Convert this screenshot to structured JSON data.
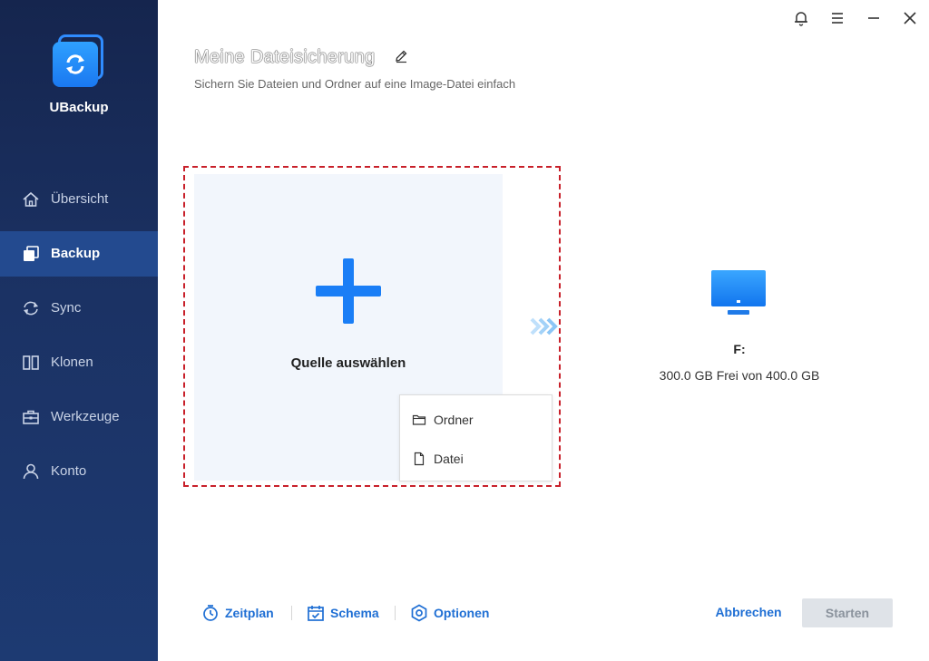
{
  "app": {
    "brand": "UBackup"
  },
  "sidebar": {
    "items": [
      {
        "label": "Übersicht",
        "icon": "home-icon"
      },
      {
        "label": "Backup",
        "icon": "backup-icon",
        "active": true
      },
      {
        "label": "Sync",
        "icon": "sync-icon"
      },
      {
        "label": "Klonen",
        "icon": "clone-icon"
      },
      {
        "label": "Werkzeuge",
        "icon": "toolbox-icon"
      },
      {
        "label": "Konto",
        "icon": "user-icon"
      }
    ]
  },
  "window_controls": [
    "bell-icon",
    "menu-icon",
    "minimize-icon",
    "close-icon"
  ],
  "task": {
    "title": "Meine Dateisicherung",
    "subtitle": "Sichern Sie Dateien und Ordner auf eine Image-Datei einfach"
  },
  "source": {
    "label": "Quelle auswählen",
    "menu": [
      {
        "label": "Ordner",
        "icon": "folder-icon"
      },
      {
        "label": "Datei",
        "icon": "file-icon"
      }
    ]
  },
  "destination": {
    "name": "F:",
    "info": "300.0 GB Frei von 400.0 GB"
  },
  "footer": {
    "options": [
      {
        "label": "Zeitplan",
        "icon": "timer-icon"
      },
      {
        "label": "Schema",
        "icon": "calendar-check-icon"
      },
      {
        "label": "Optionen",
        "icon": "settings-icon"
      }
    ],
    "cancel_label": "Abbrechen",
    "start_label": "Starten"
  },
  "colors": {
    "accent": "#1f6fd4",
    "sidebar_bg": "#1b3264",
    "highlight_dashed": "#c8202a"
  }
}
